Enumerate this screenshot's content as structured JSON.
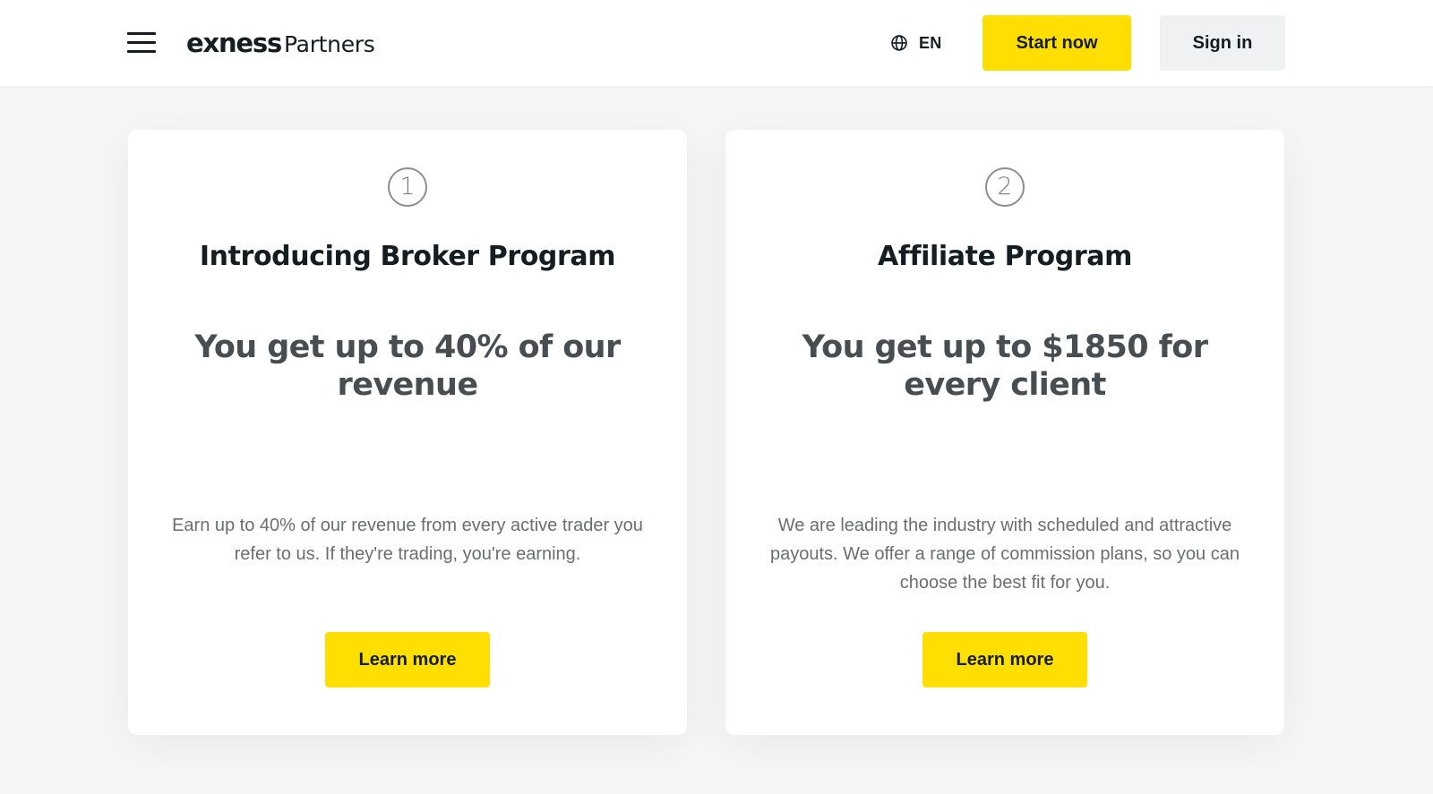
{
  "header": {
    "logo_word": "exness",
    "logo_sub": "Partners",
    "language": "EN",
    "start_label": "Start now",
    "signin_label": "Sign in"
  },
  "cards": [
    {
      "number": "1",
      "title": "Introducing Broker Program",
      "headline": "You get up to 40% of our revenue",
      "description": "Earn up to 40% of our revenue from every active trader you refer to us. If they're trading, you're earning.",
      "button_label": "Learn more"
    },
    {
      "number": "2",
      "title": "Affiliate Program",
      "headline": "You get up to $1850 for every client",
      "description": "We are leading the industry with scheduled and attractive payouts. We offer a range of commission plans, so you can choose the best fit for you.",
      "button_label": "Learn more"
    }
  ],
  "colors": {
    "accent_yellow": "#ffde02",
    "page_background": "#f6f6f6",
    "card_background": "#ffffff",
    "text_dark": "#141d22",
    "headline_gray": "#484d51",
    "body_gray": "#6a6e72",
    "signin_background": "#f0f1f2"
  },
  "icons": {
    "menu": "hamburger-menu-icon",
    "language": "globe-icon"
  }
}
